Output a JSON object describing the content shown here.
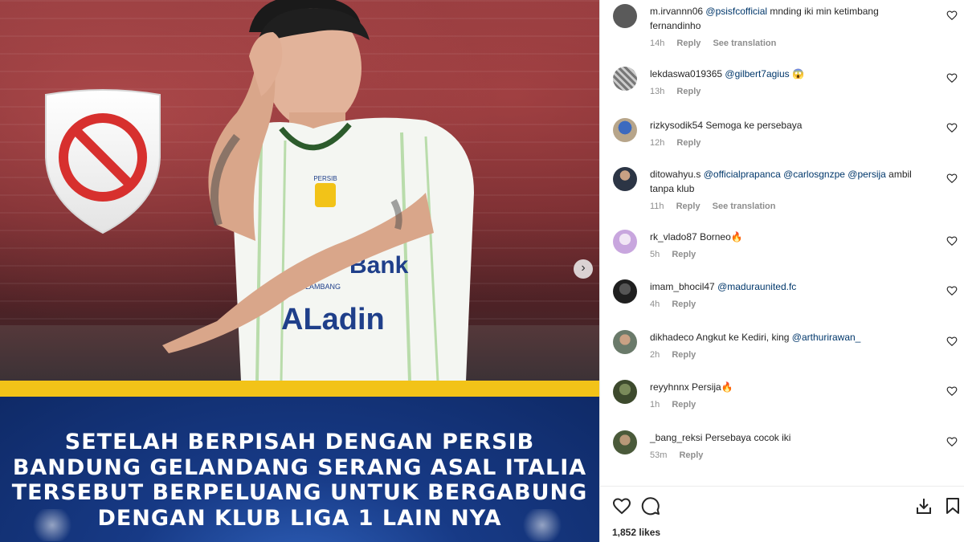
{
  "post": {
    "caption_lines": [
      "SETELAH BERPISAH DENGAN PERSIB",
      "BANDUNG GELANDANG SERANG ASAL ITALIA",
      "TERSEBUT BERPELUANG UNTUK BERGABUNG",
      "DENGAN KLUB LIGA 1 LAIN NYA"
    ],
    "jersey_text": {
      "sponsor": "ALadin",
      "badge": "PERSIB",
      "chest": "Bank",
      "sub": "LAMBANG"
    },
    "colors": {
      "banner_yellow": "#f2c318",
      "banner_blue": "#173a86",
      "ban_red": "#d7302e"
    }
  },
  "comments": [
    {
      "username": "m.irvannn06",
      "mention": "@psisfcofficial",
      "text": " mnding iki min ketimbang fernandinho",
      "time": "14h",
      "reply": "Reply",
      "translate": "See translation"
    },
    {
      "username": "lekdaswa019365",
      "mention": "@gilbert7agius",
      "text": " 😱",
      "time": "13h",
      "reply": "Reply",
      "translate": ""
    },
    {
      "username": "rizkysodik54",
      "mention": "",
      "text": "Semoga ke persebaya",
      "time": "12h",
      "reply": "Reply",
      "translate": ""
    },
    {
      "username": "ditowahyu.s",
      "mention": "@officialprapanca @carlosgnzpe @persija",
      "text": " ambil tanpa klub",
      "time": "11h",
      "reply": "Reply",
      "translate": "See translation"
    },
    {
      "username": "rk_vlado87",
      "mention": "",
      "text": "Borneo🔥",
      "time": "5h",
      "reply": "Reply",
      "translate": ""
    },
    {
      "username": "imam_bhocil47",
      "mention": "@maduraunited.fc",
      "text": "",
      "time": "4h",
      "reply": "Reply",
      "translate": ""
    },
    {
      "username": "dikhadeco",
      "mention": "",
      "text": "Angkut ke Kediri, king ",
      "mention_after": "@arthurirawan_",
      "time": "2h",
      "reply": "Reply",
      "translate": ""
    },
    {
      "username": "reyyhnnx",
      "mention": "",
      "text": "Persija🔥",
      "time": "1h",
      "reply": "Reply",
      "translate": ""
    },
    {
      "username": "_bang_reksi",
      "mention": "",
      "text": "Persebaya cocok iki",
      "time": "53m",
      "reply": "Reply",
      "translate": ""
    }
  ],
  "actions": {
    "like_icon": "heart-icon",
    "comment_icon": "comment-icon",
    "share_icon": "share-icon",
    "save_icon": "bookmark-icon",
    "likes": "1,852 likes"
  },
  "avatar_colors": [
    "#5a5a5a",
    "#8a8a8a",
    "#b7a58a",
    "#3c4a5e",
    "#d9c4e6",
    "#2a2a2a",
    "#6a7a6a",
    "#3d4a2d",
    "#6a5a4a"
  ]
}
